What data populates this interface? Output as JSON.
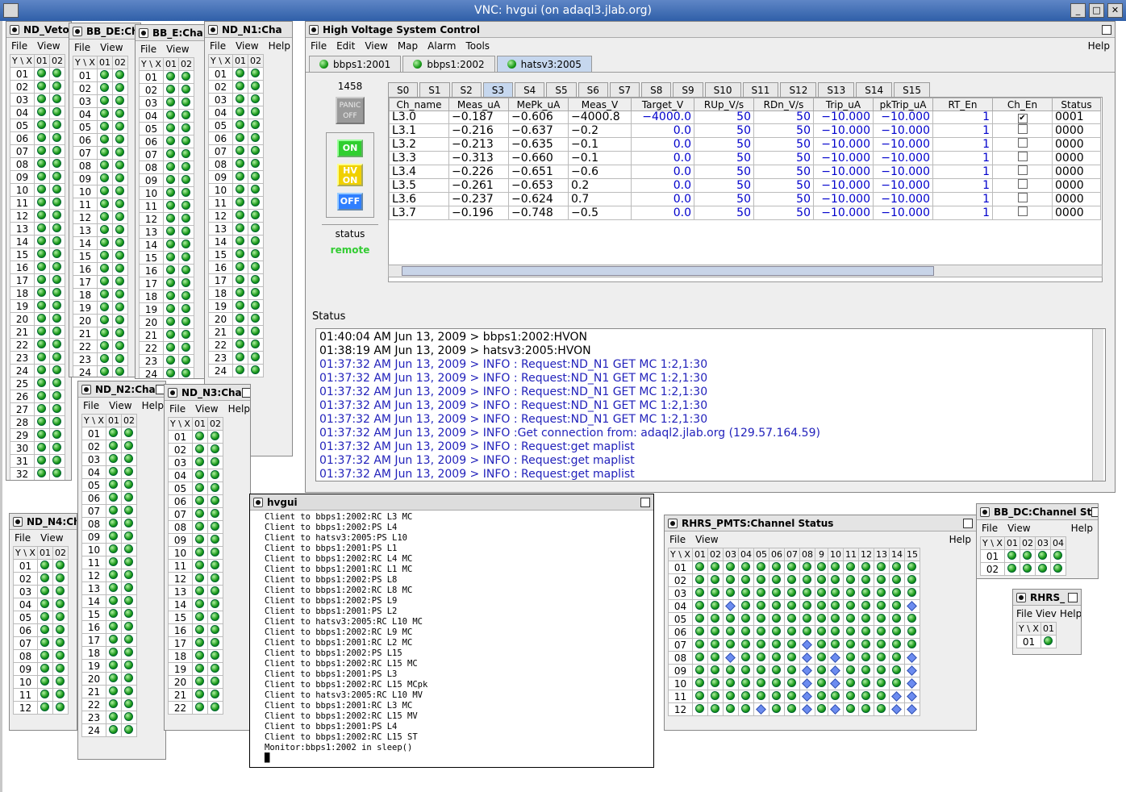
{
  "vnc": {
    "title": "VNC: hvgui (on adaql3.jlab.org)",
    "btn_min": "_",
    "btn_max": "□",
    "btn_close": "✕"
  },
  "menus": {
    "file": "File",
    "edit": "Edit",
    "view": "View",
    "map": "Map",
    "alarm": "Alarm",
    "tools": "Tools",
    "help": "Help"
  },
  "yx": "Y \\ X",
  "nd_veto": {
    "title": "ND_Veto:",
    "cols": [
      "01",
      "02"
    ],
    "rows": [
      "01",
      "02",
      "03",
      "04",
      "05",
      "06",
      "07",
      "08",
      "09",
      "10",
      "11",
      "12",
      "13",
      "14",
      "15",
      "16",
      "17",
      "18",
      "19",
      "20",
      "21",
      "22",
      "23",
      "24",
      "25",
      "26",
      "27",
      "28",
      "29",
      "30",
      "31",
      "32"
    ]
  },
  "bb_de": {
    "title": "BB_DE:Ch",
    "cols": [
      "01",
      "02"
    ],
    "rows": [
      "01",
      "02",
      "03",
      "04",
      "05",
      "06",
      "07",
      "08",
      "09",
      "10",
      "11",
      "12",
      "13",
      "14",
      "15",
      "16",
      "17",
      "18",
      "19",
      "20",
      "21",
      "22",
      "23",
      "24"
    ]
  },
  "bb_e": {
    "title": "BB_E:Cha",
    "cols": [
      "01",
      "02"
    ],
    "rows": [
      "01",
      "02",
      "03",
      "04",
      "05",
      "06",
      "07",
      "08",
      "09",
      "10",
      "11",
      "12",
      "13",
      "14",
      "15",
      "16",
      "17",
      "18",
      "19",
      "20",
      "21",
      "22",
      "23",
      "24"
    ]
  },
  "nd_n1": {
    "title": "ND_N1:Cha",
    "cols": [
      "01",
      "02"
    ],
    "rows": [
      "01",
      "02",
      "03",
      "04",
      "05",
      "06",
      "07",
      "08",
      "09",
      "10",
      "11",
      "12",
      "13",
      "14",
      "15",
      "16",
      "17",
      "18",
      "19",
      "20",
      "21",
      "22",
      "23",
      "24"
    ]
  },
  "nd_n2": {
    "title": "ND_N2:Cha",
    "cols": [
      "01",
      "02"
    ],
    "rows": [
      "01",
      "02",
      "03",
      "04",
      "05",
      "06",
      "07",
      "08",
      "09",
      "10",
      "11",
      "12",
      "13",
      "14",
      "15",
      "16",
      "17",
      "18",
      "19",
      "20",
      "21",
      "22",
      "23",
      "24"
    ]
  },
  "nd_n3": {
    "title": "ND_N3:Cha",
    "cols": [
      "01",
      "02"
    ],
    "rows": [
      "01",
      "02",
      "03",
      "04",
      "05",
      "06",
      "07",
      "08",
      "09",
      "10",
      "11",
      "12",
      "13",
      "14",
      "15",
      "16",
      "17",
      "18",
      "19",
      "20",
      "21",
      "22"
    ]
  },
  "nd_n4": {
    "title": "ND_N4:Ch",
    "cols": [
      "01",
      "02"
    ],
    "rows": [
      "01",
      "02",
      "03",
      "04",
      "05",
      "06",
      "07",
      "08",
      "09",
      "10",
      "11",
      "12"
    ]
  },
  "hv": {
    "title": "High Voltage System Control",
    "crates": [
      "bbps1:2001",
      "bbps1:2002",
      "hatsv3:2005"
    ],
    "id": "1458",
    "panic": "PANIC OFF",
    "on": "ON",
    "hvon": "HV ON",
    "off": "OFF",
    "status_label": "status",
    "status_value": "remote",
    "slots": [
      "S0",
      "S1",
      "S2",
      "S3",
      "S4",
      "S5",
      "S6",
      "S7",
      "S8",
      "S9",
      "S10",
      "S11",
      "S12",
      "S13",
      "S14",
      "S15"
    ],
    "columns": [
      "Ch_name",
      "Meas_uA",
      "MePk_uA",
      "Meas_V",
      "Target_V",
      "RUp_V/s",
      "RDn_V/s",
      "Trip_uA",
      "pkTrip_uA",
      "RT_En",
      "Ch_En",
      "Status"
    ],
    "rows": [
      [
        "L3.0",
        "−0.187",
        "−0.606",
        "−4000.8",
        "−4000.0",
        "50",
        "50",
        "−10.000",
        "−10.000",
        "1",
        true,
        "0001"
      ],
      [
        "L3.1",
        "−0.216",
        "−0.637",
        "−0.2",
        "0.0",
        "50",
        "50",
        "−10.000",
        "−10.000",
        "1",
        false,
        "0000"
      ],
      [
        "L3.2",
        "−0.213",
        "−0.635",
        "−0.1",
        "0.0",
        "50",
        "50",
        "−10.000",
        "−10.000",
        "1",
        false,
        "0000"
      ],
      [
        "L3.3",
        "−0.313",
        "−0.660",
        "−0.1",
        "0.0",
        "50",
        "50",
        "−10.000",
        "−10.000",
        "1",
        false,
        "0000"
      ],
      [
        "L3.4",
        "−0.226",
        "−0.651",
        "−0.6",
        "0.0",
        "50",
        "50",
        "−10.000",
        "−10.000",
        "1",
        false,
        "0000"
      ],
      [
        "L3.5",
        "−0.261",
        "−0.653",
        "0.2",
        "0.0",
        "50",
        "50",
        "−10.000",
        "−10.000",
        "1",
        false,
        "0000"
      ],
      [
        "L3.6",
        "−0.237",
        "−0.624",
        "0.7",
        "0.0",
        "50",
        "50",
        "−10.000",
        "−10.000",
        "1",
        false,
        "0000"
      ],
      [
        "L3.7",
        "−0.196",
        "−0.748",
        "−0.5",
        "0.0",
        "50",
        "50",
        "−10.000",
        "−10.000",
        "1",
        false,
        "0000"
      ]
    ],
    "status_title": "Status",
    "log": [
      {
        "t": "01:40:04 AM Jun 13, 2009 > bbps1:2002:HVON",
        "c": "black"
      },
      {
        "t": "01:38:19 AM Jun 13, 2009 > hatsv3:2005:HVON",
        "c": "black"
      },
      {
        "t": "01:37:32 AM Jun 13, 2009 > INFO : Request:ND_N1 GET MC 1:2,1:30",
        "c": "blue"
      },
      {
        "t": "01:37:32 AM Jun 13, 2009 > INFO : Request:ND_N1 GET MC 1:2,1:30",
        "c": "blue"
      },
      {
        "t": "01:37:32 AM Jun 13, 2009 > INFO : Request:ND_N1 GET MC 1:2,1:30",
        "c": "blue"
      },
      {
        "t": "01:37:32 AM Jun 13, 2009 > INFO : Request:ND_N1 GET MC 1:2,1:30",
        "c": "blue"
      },
      {
        "t": "01:37:32 AM Jun 13, 2009 > INFO : Request:ND_N1 GET MC 1:2,1:30",
        "c": "blue"
      },
      {
        "t": "01:37:32 AM Jun 13, 2009 > INFO :Get connection from: adaql2.jlab.org (129.57.164.59)",
        "c": "blue"
      },
      {
        "t": "01:37:32 AM Jun 13, 2009 > INFO : Request:get maplist",
        "c": "blue"
      },
      {
        "t": "01:37:32 AM Jun 13, 2009 > INFO : Request:get maplist",
        "c": "blue"
      },
      {
        "t": "01:37:32 AM Jun 13, 2009 > INFO : Request:get maplist",
        "c": "blue"
      }
    ]
  },
  "hvgui_term": {
    "title": "hvgui",
    "lines": [
      "Client to bbps1:2002:RC L3 MC",
      "Client to bbps1:2002:PS L4",
      "Client to hatsv3:2005:PS L10",
      "Client to bbps1:2001:PS L1",
      "Client to bbps1:2002:RC L4 MC",
      "Client to bbps1:2001:RC L1 MC",
      "Client to bbps1:2002:PS L8",
      "Client to bbps1:2002:RC L8 MC",
      "Client to bbps1:2002:PS L9",
      "Client to bbps1:2001:PS L2",
      "Client to hatsv3:2005:RC L10 MC",
      "Client to bbps1:2002:RC L9 MC",
      "Client to bbps1:2001:RC L2 MC",
      "Client to bbps1:2002:PS L15",
      "Client to bbps1:2002:RC L15 MC",
      "Client to bbps1:2001:PS L3",
      "Client to bbps1:2002:RC L15 MCpk",
      "Client to hatsv3:2005:RC L10 MV",
      "Client to bbps1:2001:RC L3 MC",
      "Client to bbps1:2002:RC L15 MV",
      "Client to bbps1:2001:PS L4",
      "Client to bbps1:2002:RC L15 ST",
      "Monitor:bbps1:2002 in sleep()"
    ]
  },
  "rhrs_pmts": {
    "title": "RHRS_PMTS:Channel Status",
    "cols": [
      "01",
      "02",
      "03",
      "04",
      "05",
      "06",
      "07",
      "08",
      "9",
      "10",
      "11",
      "12",
      "13",
      "14",
      "15"
    ],
    "rows": [
      "01",
      "02",
      "03",
      "04",
      "05",
      "06",
      "07",
      "08",
      "09",
      "10",
      "11",
      "12"
    ]
  },
  "bb_dc": {
    "title": "BB_DC:Channel St",
    "cols": [
      "01",
      "02",
      "03",
      "04"
    ],
    "rows": [
      "01",
      "02"
    ]
  },
  "rhrs": {
    "title": "RHRS_",
    "cols": [
      "01"
    ],
    "rows": [
      "01"
    ],
    "file": "File",
    "view": "Viev",
    "help": "Help"
  }
}
